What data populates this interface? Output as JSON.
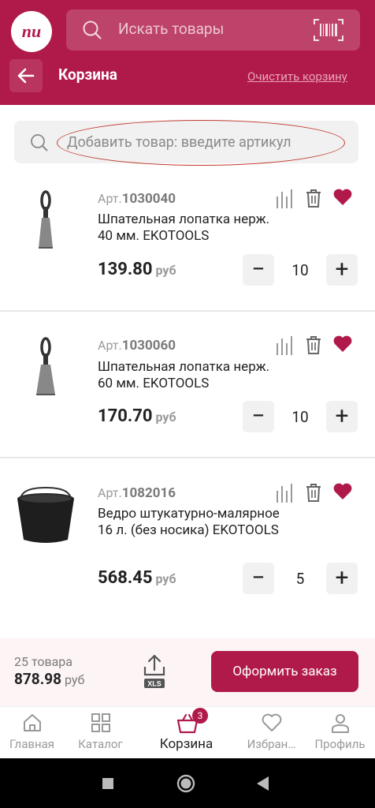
{
  "header": {
    "logo_text": "пи",
    "search_placeholder": "Искать товары",
    "title": "Корзина",
    "clear_label": "Очистить корзину"
  },
  "add_item": {
    "placeholder": "Добавить товар: введите артикул"
  },
  "items": [
    {
      "art_prefix": "Арт.",
      "art": "1030040",
      "name": "Шпательная лопатка нерж. 40 мм. EKOTOOLS",
      "price": "139.80",
      "currency": "руб",
      "qty": "10",
      "favorite": true
    },
    {
      "art_prefix": "Арт.",
      "art": "1030060",
      "name": "Шпательная лопатка нерж. 60 мм. EKOTOOLS",
      "price": "170.70",
      "currency": "руб",
      "qty": "10",
      "favorite": true
    },
    {
      "art_prefix": "Арт.",
      "art": "1082016",
      "name": "Ведро штукатурно-малярное 16 л. (без носика)  EKOTOOLS",
      "price": "568.45",
      "currency": "руб",
      "qty": "5",
      "favorite": true
    }
  ],
  "footer": {
    "count": "25 товара",
    "total": "878.98",
    "currency": "руб",
    "xls_label": "XLS",
    "order_label": "Оформить заказ"
  },
  "tabs": [
    {
      "label": "Главная",
      "icon": "home-icon"
    },
    {
      "label": "Каталог",
      "icon": "grid-icon"
    },
    {
      "label": "Корзина",
      "icon": "basket-icon",
      "badge": "3",
      "active": true
    },
    {
      "label": "Избран…",
      "icon": "heart-icon"
    },
    {
      "label": "Профиль",
      "icon": "user-icon"
    }
  ],
  "colors": {
    "brand": "#b01a4a",
    "highlight_ellipse": "#c0392b"
  }
}
